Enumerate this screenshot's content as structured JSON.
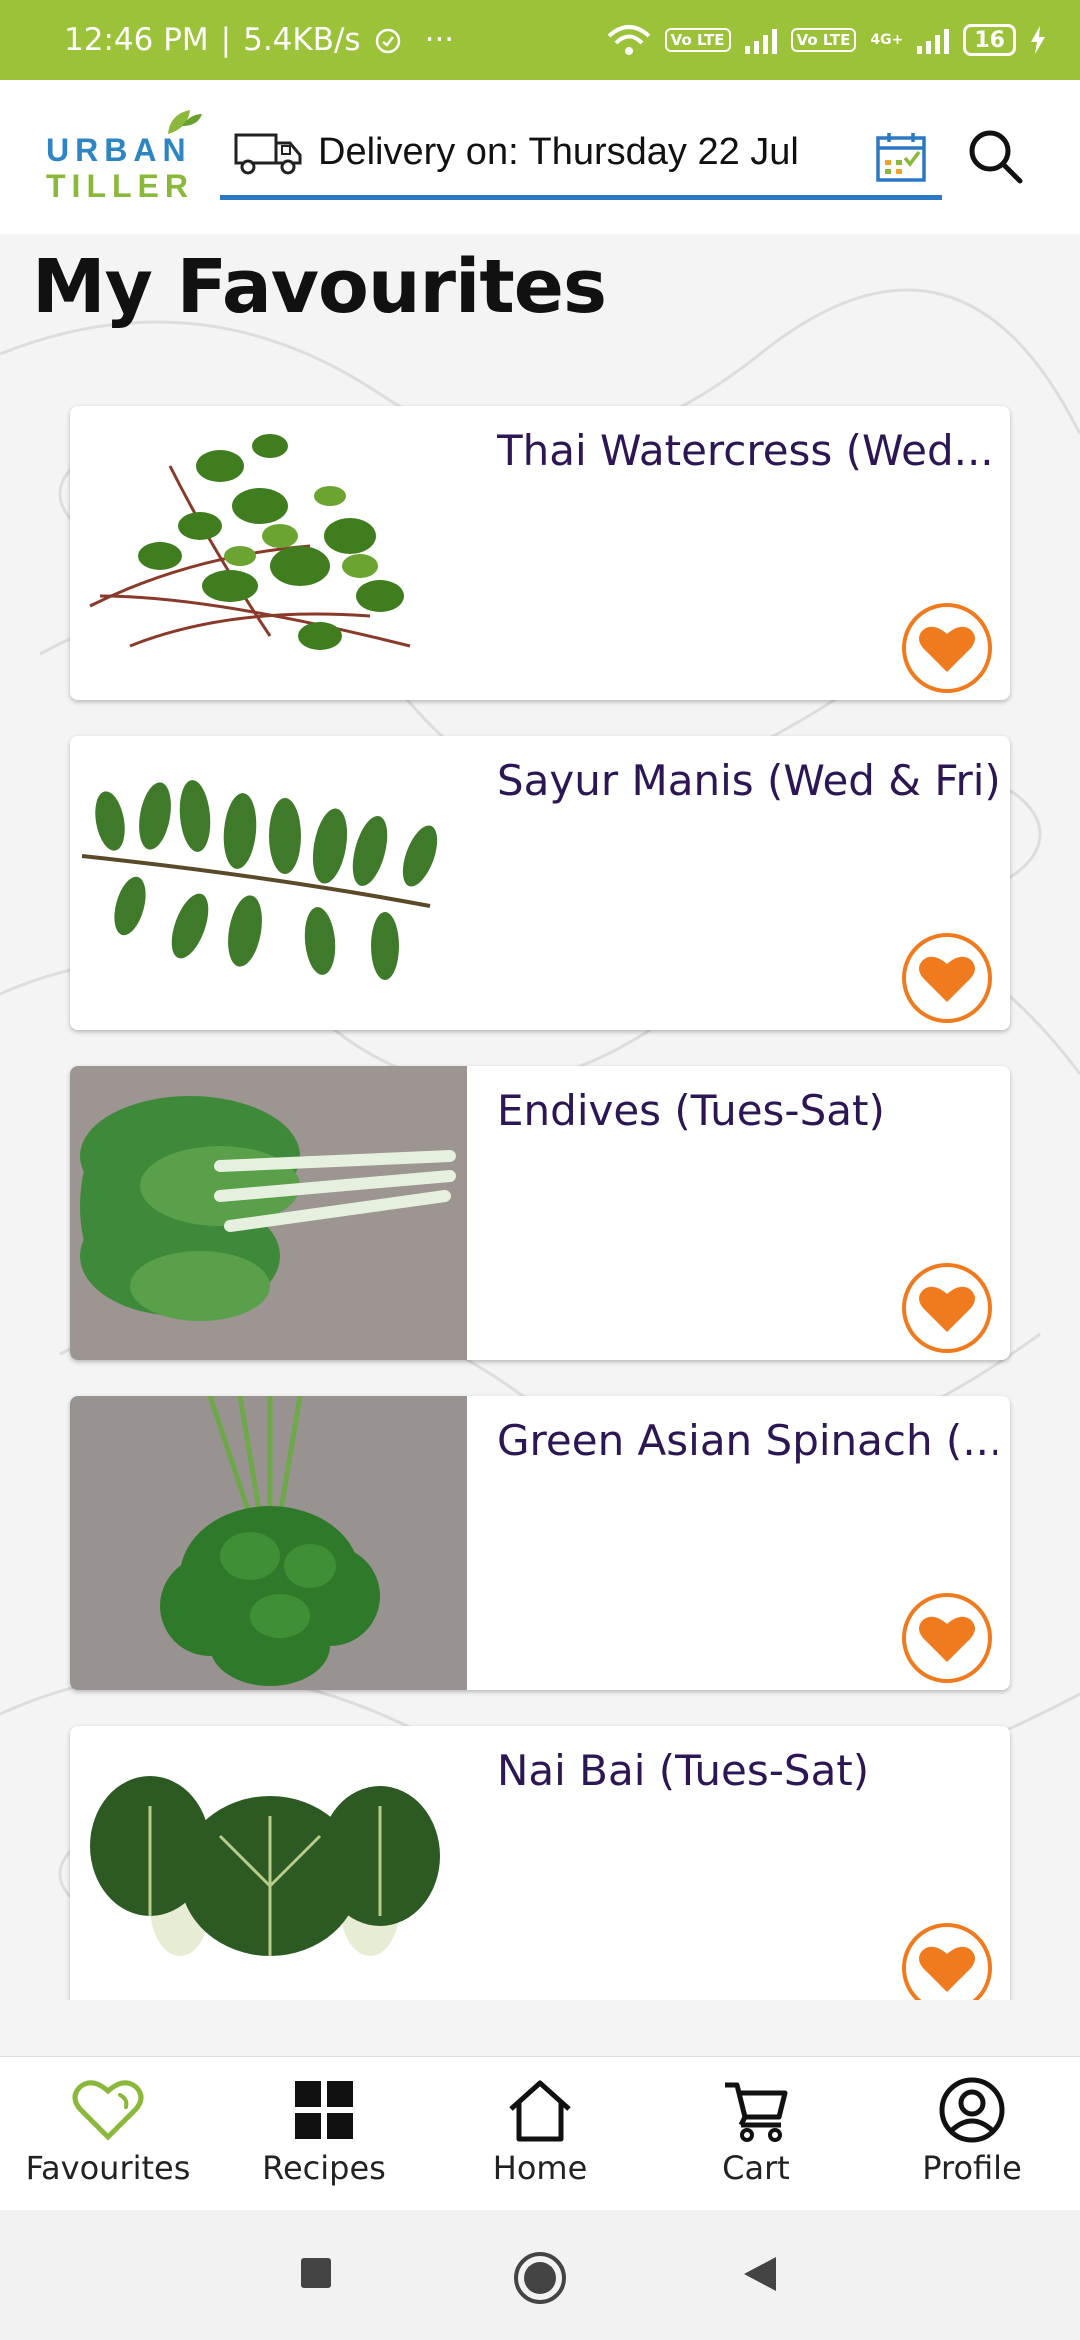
{
  "status_bar": {
    "time": "12:46 PM",
    "speed": "5.4KB/s",
    "more": "···",
    "volte1": "Vo LTE",
    "volte2": "Vo LTE",
    "network": "4G+",
    "battery": "16"
  },
  "header": {
    "logo_line1": "URBAN",
    "logo_line2": "TILLER",
    "delivery_text": "Delivery on: Thursday 22 Jul",
    "icons": [
      "truck-icon",
      "calendar-icon",
      "search-icon"
    ]
  },
  "page": {
    "title": "My Favourites"
  },
  "favourites": [
    {
      "name": "Thai Watercress (Wed...",
      "image": "watercress"
    },
    {
      "name": "Sayur Manis (Wed & Fri)",
      "image": "sayur-manis"
    },
    {
      "name": "Endives (Tues-Sat)",
      "image": "endives"
    },
    {
      "name": "Green Asian Spinach (...",
      "image": "spinach"
    },
    {
      "name": "Nai Bai (Tues-Sat)",
      "image": "nai-bai"
    }
  ],
  "bottom_nav": {
    "items": [
      {
        "label": "Favourites",
        "icon": "heart-icon",
        "active": true
      },
      {
        "label": "Recipes",
        "icon": "grid-icon"
      },
      {
        "label": "Home",
        "icon": "home-icon"
      },
      {
        "label": "Cart",
        "icon": "cart-icon"
      },
      {
        "label": "Profile",
        "icon": "profile-icon"
      }
    ]
  },
  "colors": {
    "status_bar": "#9cc23a",
    "accent_blue": "#2b79c2",
    "heart_orange": "#f07b1f",
    "title_purple": "#2c1653",
    "active_green": "#8ab83a"
  }
}
